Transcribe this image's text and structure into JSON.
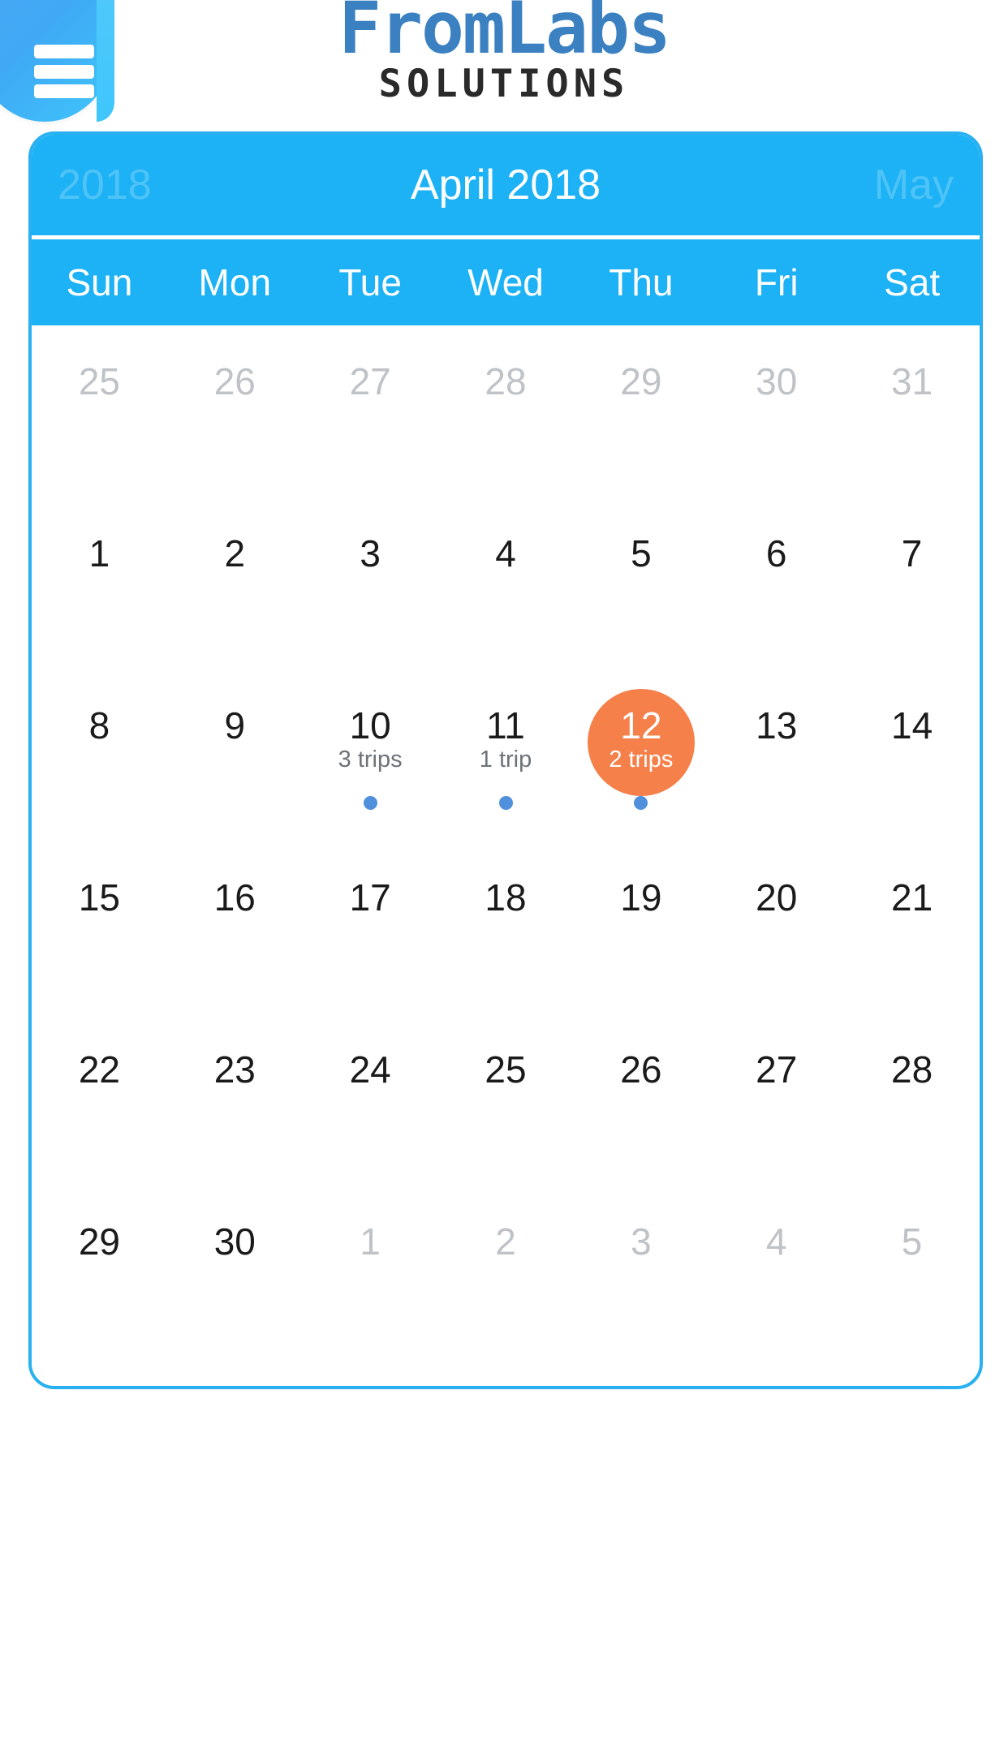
{
  "brand": {
    "menu_icon": "hamburger-menu-icon",
    "name": "FromLabs",
    "tagline": "SOLUTIONS",
    "logo_color": "#3B81C2",
    "tagline_color": "#2A2A2A"
  },
  "calendar": {
    "prev_label": "2018",
    "title": "April 2018",
    "next_label": "May",
    "header_color": "#1DB2F5",
    "border_color": "#29B0F1",
    "selected_color": "#F5804A",
    "dot_color": "#4F8FDC",
    "weekdays": [
      "Sun",
      "Mon",
      "Tue",
      "Wed",
      "Thu",
      "Fri",
      "Sat"
    ],
    "weeks": [
      [
        {
          "day": "25",
          "muted": true
        },
        {
          "day": "26",
          "muted": true
        },
        {
          "day": "27",
          "muted": true
        },
        {
          "day": "28",
          "muted": true
        },
        {
          "day": "29",
          "muted": true
        },
        {
          "day": "30",
          "muted": true
        },
        {
          "day": "31",
          "muted": true
        }
      ],
      [
        {
          "day": "1"
        },
        {
          "day": "2"
        },
        {
          "day": "3"
        },
        {
          "day": "4"
        },
        {
          "day": "5"
        },
        {
          "day": "6"
        },
        {
          "day": "7"
        }
      ],
      [
        {
          "day": "8"
        },
        {
          "day": "9"
        },
        {
          "day": "10",
          "trips": "3 trips",
          "dot": true
        },
        {
          "day": "11",
          "trips": "1 trip",
          "dot": true
        },
        {
          "day": "12",
          "trips": "2 trips",
          "dot": true,
          "selected": true
        },
        {
          "day": "13"
        },
        {
          "day": "14"
        }
      ],
      [
        {
          "day": "15"
        },
        {
          "day": "16"
        },
        {
          "day": "17"
        },
        {
          "day": "18"
        },
        {
          "day": "19"
        },
        {
          "day": "20"
        },
        {
          "day": "21"
        }
      ],
      [
        {
          "day": "22"
        },
        {
          "day": "23"
        },
        {
          "day": "24"
        },
        {
          "day": "25"
        },
        {
          "day": "26"
        },
        {
          "day": "27"
        },
        {
          "day": "28"
        }
      ],
      [
        {
          "day": "29"
        },
        {
          "day": "30"
        },
        {
          "day": "1",
          "muted": true
        },
        {
          "day": "2",
          "muted": true
        },
        {
          "day": "3",
          "muted": true
        },
        {
          "day": "4",
          "muted": true
        },
        {
          "day": "5",
          "muted": true
        }
      ]
    ]
  }
}
